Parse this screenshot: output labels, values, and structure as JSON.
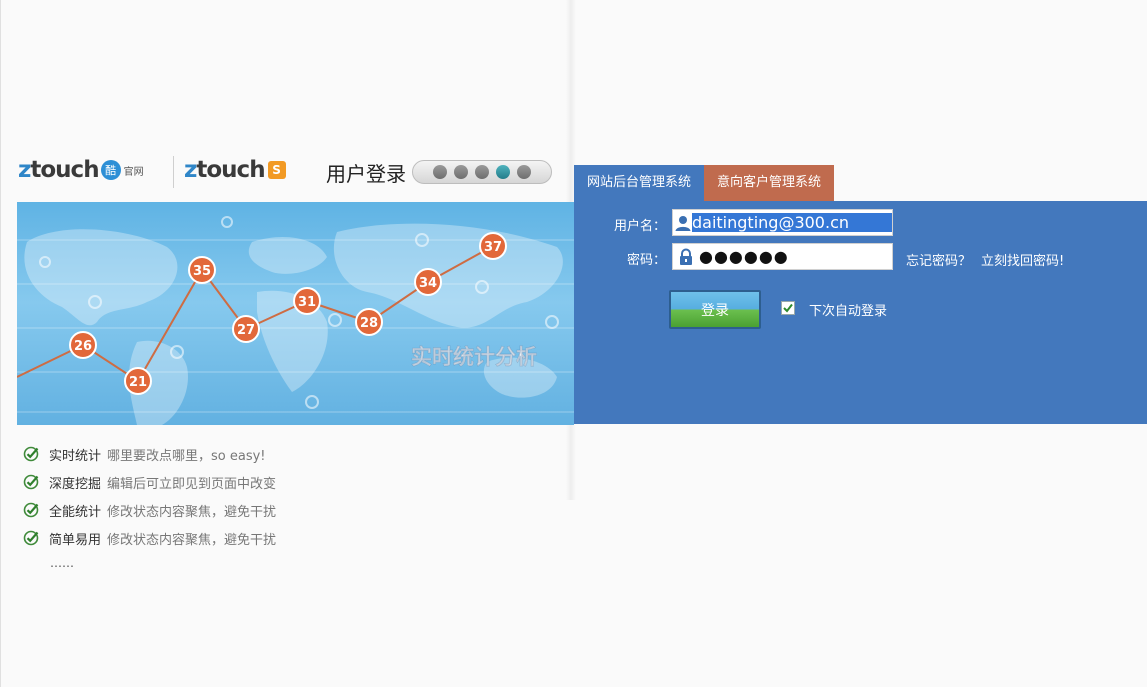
{
  "header": {
    "logo1": {
      "brand_z": "z",
      "brand_rest": "touch",
      "badge": "酷",
      "sub": "官网"
    },
    "logo2": {
      "brand_z": "z",
      "brand_rest": "touch",
      "badge": "S"
    },
    "title": "用户登录",
    "slider_dots": 5,
    "active_dot": 4
  },
  "banner": {
    "caption": "实时统计分析",
    "points": [
      "26",
      "21",
      "35",
      "27",
      "31",
      "28",
      "34",
      "37"
    ]
  },
  "features": [
    {
      "title": "实时统计",
      "desc": "哪里要改点哪里，so easy!"
    },
    {
      "title": "深度挖掘",
      "desc": "编辑后可立即见到页面中改变"
    },
    {
      "title": "全能统计",
      "desc": "修改状态内容聚焦，避免干扰"
    },
    {
      "title": "简单易用",
      "desc": "修改状态内容聚焦，避免干扰"
    }
  ],
  "ellipsis": "……",
  "tabs": [
    {
      "label": "网站后台管理系统"
    },
    {
      "label": "意向客户管理系统"
    }
  ],
  "form": {
    "username_label": "用户名：",
    "username_value": "daitingting@300.cn",
    "password_label": "密码：",
    "password_mask": "●●●●●●",
    "forgot_label": "忘记密码？",
    "recover_label": "立刻找回密码!",
    "login_button": "登录",
    "remember_label": "下次自动登录",
    "remember_checked": true
  },
  "colors": {
    "panel_blue": "#4378bd",
    "tab_active": "#c06b4e",
    "accent_orange": "#e2683a"
  }
}
